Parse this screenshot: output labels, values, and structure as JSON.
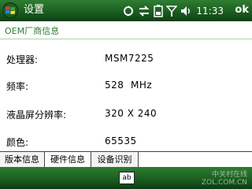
{
  "titlebar": {
    "title": "设置",
    "clock": "11:33",
    "ok_label": "ok"
  },
  "section": {
    "label": "OEM厂商信息"
  },
  "info_rows": [
    {
      "key": "处理器:",
      "value": "MSM7225"
    },
    {
      "key": "频率:",
      "value": "528  MHz"
    },
    {
      "key": "液晶屏分辨率:",
      "value": "320 X 240"
    },
    {
      "key": "颜色:",
      "value": "65535"
    }
  ],
  "tabs": [
    {
      "label": "版本信息"
    },
    {
      "label": "硬件信息"
    },
    {
      "label": "设备识别"
    }
  ],
  "menubar": {
    "keyboard_label": "ab",
    "watermark_line1": "中关村在线",
    "watermark_line2": "ZOL.COM.CN"
  },
  "colors": {
    "accent_green": "#2e7d32",
    "bar_dark": "#1b5e20"
  },
  "icons": [
    "windows-start-icon",
    "connectivity-icon",
    "sync-arrows-icon",
    "battery-icon",
    "signal-icon",
    "volume-icon"
  ]
}
